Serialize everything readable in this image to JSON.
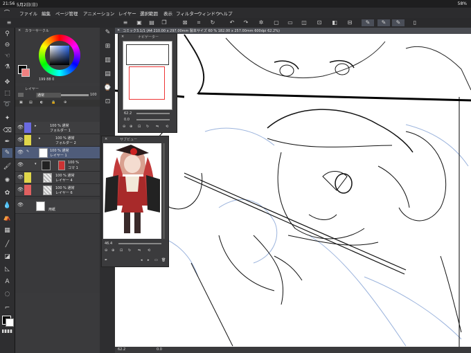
{
  "status": {
    "time": "21:56",
    "date": "5月2日(日)",
    "battery": "58%"
  },
  "menu": {
    "items": [
      "ファイル",
      "編集",
      "ページ管理",
      "アニメーション",
      "レイヤー",
      "選択範囲",
      "表示",
      "フィルター",
      "ウィンドウ",
      "ヘルプ"
    ]
  },
  "document": {
    "title": "コミック3.1/1 (A4 210.00 x 297.00mm 製本サイズ 60 % 182.00 x 257.00mm 600dpi 62.2%)"
  },
  "color_panel": {
    "title": "カラーサークル",
    "value": "199 88 0"
  },
  "layer_panel": {
    "title": "レイヤー",
    "blend_mode": "通常",
    "opacity": "100",
    "layers": [
      {
        "line1": "100 % 通常",
        "line2": "フォルダー 1",
        "color": "#6a6ae0"
      },
      {
        "line1": "100 % 通常",
        "line2": "フォルダー 2",
        "color": "#e0d64a"
      },
      {
        "line1": "100 % 通常",
        "line2": "レイヤー 1",
        "color": ""
      },
      {
        "line1": "100 %",
        "line2": "コマ 1",
        "color": ""
      },
      {
        "line1": "100 % 通常",
        "line2": "レイヤー 4",
        "color": "#e0d64a"
      },
      {
        "line1": "100 % 通常",
        "line2": "レイヤー 6",
        "color": "#e06060"
      },
      {
        "line1": "",
        "line2": "用紙",
        "color": ""
      }
    ]
  },
  "navigator": {
    "title": "ナビゲーター",
    "zoom": "62.2",
    "angle": "0.0"
  },
  "subview": {
    "title": "サブビュー",
    "zoom": "46.4"
  },
  "bottom": {
    "zoom": "62.2",
    "angle": "0.0"
  }
}
